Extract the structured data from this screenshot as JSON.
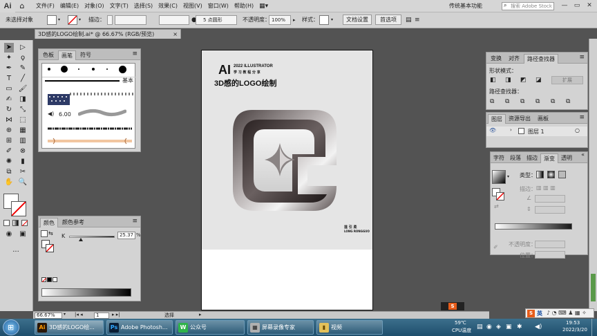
{
  "app": {
    "logo": "Ai"
  },
  "menu": [
    "文件(F)",
    "编辑(E)",
    "对象(O)",
    "文字(T)",
    "选择(S)",
    "效果(C)",
    "视图(V)",
    "窗口(W)",
    "帮助(H)"
  ],
  "workspace": "传统基本功能",
  "stock_search": {
    "placeholder": "搜索 Adobe Stock"
  },
  "controlbar": {
    "no_selection": "未选择对象",
    "stroke_label": "描边：",
    "brush": "5 点圆形",
    "opacity_label": "不透明度：",
    "opacity_value": "100%",
    "style_label": "样式：",
    "doc_setup": "文档设置",
    "prefs": "首选项"
  },
  "document_tab": {
    "title": "3D感的LOGO绘制.ai* @ 66.67% (RGB/预览)",
    "close": "×"
  },
  "brushes_panel": {
    "tabs": [
      "色板",
      "画笔",
      "符号"
    ],
    "basic_label": "基本",
    "size_label": "6.00"
  },
  "color_panel": {
    "tabs": [
      "颜色",
      "颜色参考"
    ],
    "channel_label": "K",
    "k_value": "25.37",
    "percent": "%"
  },
  "pathfinder_panel": {
    "tabs": [
      "变换",
      "对齐",
      "路径查找器"
    ],
    "shape_modes": "形状模式：",
    "expand": "扩展",
    "pathfinders": "路径查找器："
  },
  "layers_panel": {
    "tabs": [
      "图层",
      "资源导出",
      "画板"
    ],
    "layer_name": "图层 1"
  },
  "gradient_panel": {
    "tabs": [
      "字符",
      "段落",
      "描边",
      "渐变",
      "透明"
    ],
    "type_label": "类型：",
    "stroke_label": "描边：",
    "opacity_label": "不透明度：",
    "position_label": "位置："
  },
  "artboard": {
    "ai_mark": "AI",
    "year_line": "2022 ILLUSTRATOR",
    "sub_line": "学 习 教 程 分 享",
    "title": "3D感的LOGO绘制",
    "author_cn": "莲 引 柔",
    "author_en": "LONG RONGGUO"
  },
  "status": {
    "zoom": "66.67%",
    "page": "1",
    "mode": "选择"
  },
  "taskbar": {
    "tasks": [
      {
        "icon": "Ai",
        "label": "3D感的LOGO绘...",
        "color": "#2a1708",
        "text": "#ff9a00"
      },
      {
        "icon": "Ps",
        "label": "Adobe Photosh...",
        "color": "#0b1d33",
        "text": "#31a8ff"
      },
      {
        "icon": "W",
        "label": "公众号",
        "color": "#2fb34a",
        "text": "#ffffff"
      },
      {
        "icon": "▦",
        "label": "屏幕录像专家",
        "color": "#b0b0b0",
        "text": "#222222"
      },
      {
        "icon": "▮",
        "label": "视频",
        "color": "#e4c15a",
        "text": "#6a4a00"
      }
    ],
    "weather_temp": "59℃",
    "weather_label": "CPU温度",
    "time": "19:53",
    "date": "2022/3/20",
    "ime": "英"
  }
}
